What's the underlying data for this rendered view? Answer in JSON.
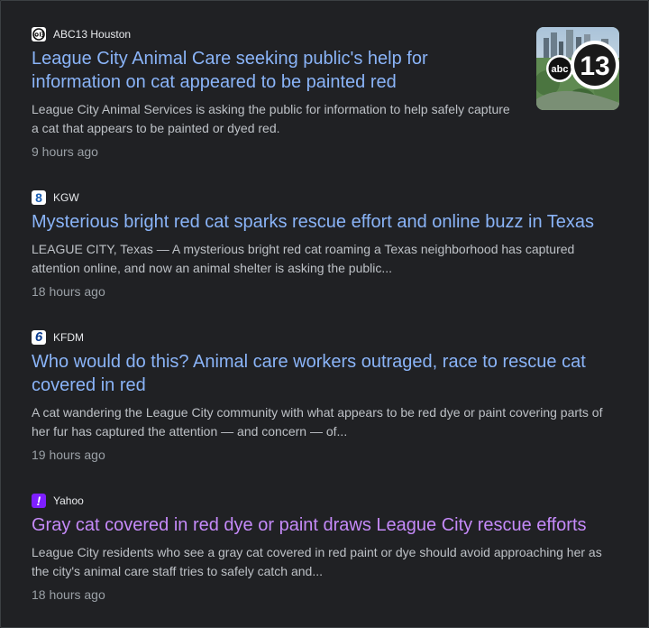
{
  "articles": [
    {
      "source": "ABC13 Houston",
      "favicon_icon": "abc13-logo-icon",
      "headline": "League City Animal Care seeking public's help for information on cat appeared to be painted red",
      "snippet": "League City Animal Services is asking the public for information to help safely capture a cat that appears to be painted or dyed red.",
      "time": "9 hours ago",
      "thumbnail_logo": "13"
    },
    {
      "source": "KGW",
      "favicon_icon": "kgw-8-logo-icon",
      "favicon_glyph": "8",
      "headline": "Mysterious bright red cat sparks rescue effort and online buzz in Texas",
      "snippet": "LEAGUE CITY, Texas — A mysterious bright red cat roaming a Texas neighborhood has captured attention online, and now an animal shelter is asking the public...",
      "time": "18 hours ago"
    },
    {
      "source": "KFDM",
      "favicon_icon": "kfdm-6-logo-icon",
      "favicon_glyph": "6",
      "headline": "Who would do this? Animal care workers outraged, race to rescue cat covered in red",
      "snippet": "A cat wandering the League City community with what appears to be red dye or paint covering parts of her fur has captured the attention — and concern — of...",
      "time": "19 hours ago"
    },
    {
      "source": "Yahoo",
      "favicon_icon": "yahoo-exclamation-logo-icon",
      "favicon_glyph": "!",
      "headline": "Gray cat covered in red dye or paint draws League City rescue efforts",
      "snippet": "League City residents who see a gray cat covered in red paint or dye should avoid approaching her as the city's animal care staff tries to safely catch and...",
      "time": "18 hours ago",
      "visited": true
    }
  ],
  "colors": {
    "background": "#202124",
    "link": "#8ab4f8",
    "visited_link": "#c58af9",
    "snippet": "#bdc1c6",
    "source": "#e8eaed",
    "time": "#9aa0a6"
  }
}
